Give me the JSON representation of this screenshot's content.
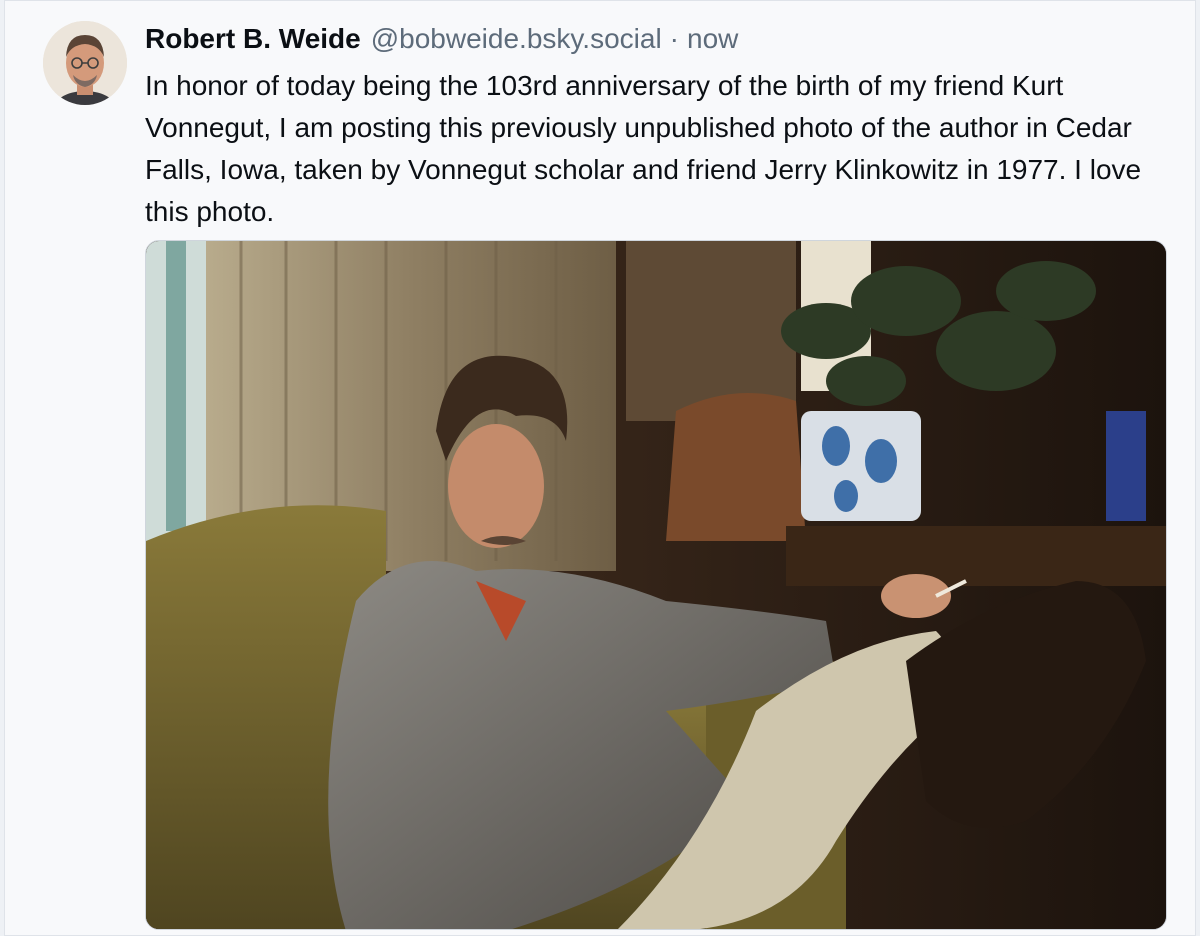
{
  "post": {
    "author": {
      "display_name": "Robert B. Weide",
      "handle": "@bobweide.bsky.social",
      "avatar_icon": "user-avatar-photo"
    },
    "separator": "·",
    "timestamp": "now",
    "text": "In honor of today being the 103rd anniversary of the birth of my friend Kurt Vonnegut, I am posting this previously unpublished photo of the author in Cedar Falls, Iowa, taken by Vonnegut scholar and friend Jerry Klinkowitz in 1977. I love this photo.",
    "image": {
      "kind": "photo",
      "subject": "man-seated-in-armchair"
    }
  },
  "colors": {
    "page_background": "#eef1f5",
    "post_background": "#f8f9fb",
    "text_primary": "#0b0f14",
    "text_secondary": "#5d6b7a"
  }
}
